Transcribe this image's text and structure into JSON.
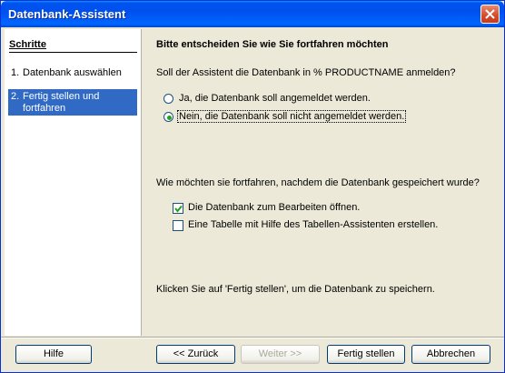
{
  "window": {
    "title": "Datenbank-Assistent"
  },
  "sidebar": {
    "heading": "Schritte",
    "steps": [
      {
        "num": "1.",
        "label": "Datenbank auswählen"
      },
      {
        "num": "2.",
        "label": "Fertig stellen und fortfahren"
      }
    ]
  },
  "main": {
    "title": "Bitte entscheiden Sie wie Sie fortfahren möchten",
    "register_question": "Soll der Assistent die Datenbank in % PRODUCTNAME anmelden?",
    "radio_yes": "Ja, die Datenbank soll angemeldet werden.",
    "radio_no": "Nein, die Datenbank soll nicht angemeldet werden.",
    "radio_selected": "no",
    "continue_question": "Wie möchten sie fortfahren, nachdem die Datenbank gespeichert wurde?",
    "check_edit": "Die Datenbank zum  Bearbeiten öffnen.",
    "check_edit_checked": true,
    "check_table": "Eine Tabelle mit Hilfe des Tabellen-Assistenten erstellen.",
    "check_table_checked": false,
    "footer_message": "Klicken Sie auf 'Fertig stellen', um die Datenbank zu speichern."
  },
  "buttons": {
    "help": "Hilfe",
    "back": "<< Zurück",
    "next": "Weiter >>",
    "finish": "Fertig stellen",
    "cancel": "Abbrechen"
  },
  "colors": {
    "titlebar": "#0054e3",
    "selection": "#316ac5",
    "radio_dot": "#21a121"
  }
}
